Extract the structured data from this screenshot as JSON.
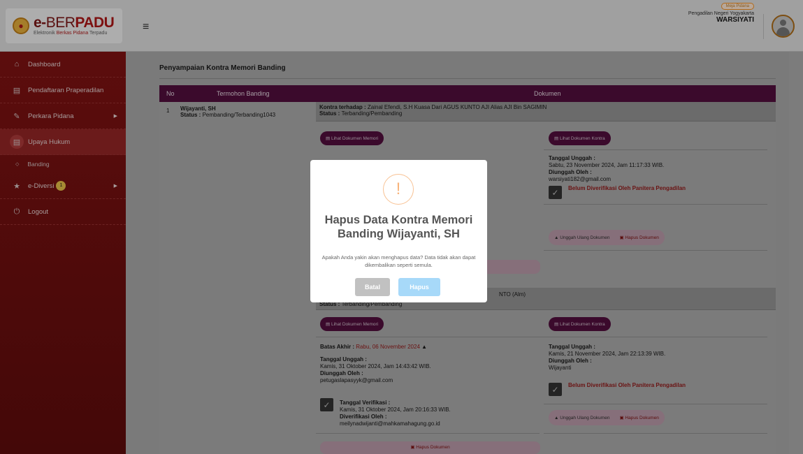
{
  "header": {
    "logo_prefix": "e-",
    "logo_mid": "BER",
    "logo_end": "PADU",
    "logo_sub_a": "Elektronik ",
    "logo_sub_b": "Berkas Pidana",
    "logo_sub_c": " Terpadu",
    "role_badge": "Meja Pidana",
    "court_name": "Pengadilan Negeri Yogyakarta",
    "user_name": "WARSIYATI"
  },
  "sidebar": {
    "items": [
      {
        "label": "Dashboard",
        "icon": "home-icon"
      },
      {
        "label": "Pendaftaran Praperadilan",
        "icon": "folder-icon"
      },
      {
        "label": "Perkara Pidana",
        "icon": "edit-icon"
      },
      {
        "label": "Upaya Hukum",
        "icon": "folder-icon"
      },
      {
        "label": "Banding",
        "icon": "diamond-icon"
      },
      {
        "label": "e-Diversi",
        "icon": "star-icon",
        "badge": "1"
      },
      {
        "label": "Logout",
        "icon": "power-icon"
      }
    ]
  },
  "main": {
    "section_title": "Penyampaian Kontra Memori Banding",
    "columns": [
      "No",
      "Termohon Banding",
      "Dokumen"
    ],
    "row": {
      "no": "1",
      "name": "Wijayanti, SH",
      "status_label": "Status : ",
      "status_value": "Pembanding/Terbanding1043"
    },
    "doc1": {
      "kontra_label": "Kontra terhadap : ",
      "kontra_value": "Zainal Efendi, S.H Kuasa Dari AGUS KUNTO AJI Alias AJI Bin SAGIMIN",
      "status_label": "Status : ",
      "status_value": "Terbanding/Pembanding",
      "btn_memori": "Lihat Dokumen Memori",
      "btn_kontra": "Lihat Dokumen Kontra",
      "upload_label": "Tanggal Unggah :",
      "upload_value": "Sabtu, 23 November 2024, Jam 11:17:33 WIB.",
      "by_label": "Diunggah Oleh :",
      "by_value": "warsiyati182@gmail.com",
      "verify_warning": "Belum Diverifikasi Oleh Panitera Pengadilan",
      "reupload": "Unggah Ulang Dokumen",
      "delete": "Hapus Dokumen"
    },
    "doc2": {
      "kontra_partial": "NTO (Alm)",
      "status_label": "Status : ",
      "status_value": "Terbanding/Pembanding",
      "btn_memori": "Lihat Dokumen Memori",
      "btn_kontra": "Lihat Dokumen Kontra",
      "deadline_label": "Batas Akhir : ",
      "deadline_value": "Rabu, 06 November 2024",
      "left_upload_label": "Tanggal Unggah :",
      "left_upload_value": "Kamis, 31 Oktober 2024, Jam 14:43:42 WIB.",
      "left_by_label": "Diunggah Oleh :",
      "left_by_value": "petugaslapasyyk@gmail.com",
      "verify_date_label": "Tanggal Verifikasi :",
      "verify_date_value": "Kamis, 31 Oktober 2024, Jam 20:16:33 WIB.",
      "verify_by_label": "Diverifikasi Oleh :",
      "verify_by_value": "meilynadwijanti@mahkamahagung.go.id",
      "left_delete": "Hapus Dokumen",
      "upload_label": "Tanggal Unggah :",
      "upload_value": "Kamis, 21 November 2024, Jam 22:13:39 WIB.",
      "by_label": "Diunggah Oleh :",
      "by_value": "Wijayanti",
      "verify_warning": "Belum Diverifikasi Oleh Panitera Pengadilan",
      "reupload": "Unggah Ulang Dokumen",
      "delete": "Hapus Dokumen"
    }
  },
  "modal": {
    "icon": "!",
    "title_line1": "Hapus Data Kontra Memori",
    "title_line2": "Banding Wijayanti, SH",
    "text": "Apakah Anda yakin akan menghapus data? Data tidak akan dapat dikembalikan seperti semula.",
    "cancel": "Batal",
    "confirm": "Hapus"
  }
}
